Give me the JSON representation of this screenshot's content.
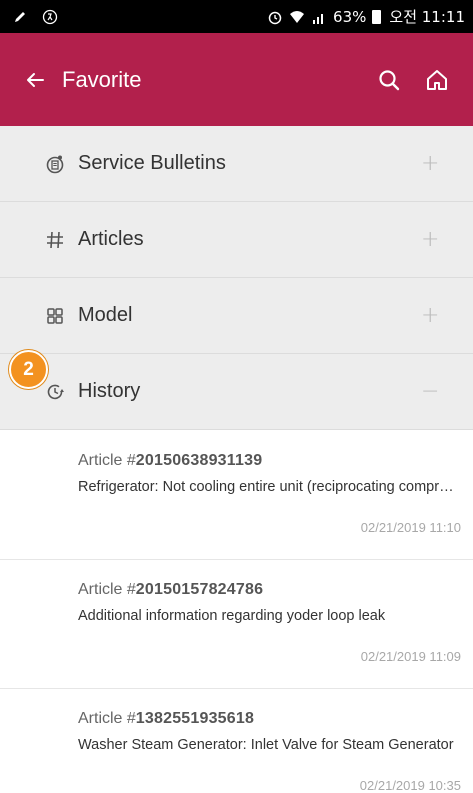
{
  "status_bar": {
    "battery_text": "63%",
    "time_text": "오전 11:11"
  },
  "app_bar": {
    "title": "Favorite"
  },
  "menu": {
    "items": [
      {
        "label": "Service Bulletins",
        "toggle": "+",
        "icon": "bulletin-icon"
      },
      {
        "label": "Articles",
        "toggle": "+",
        "icon": "hash-icon"
      },
      {
        "label": "Model",
        "toggle": "+",
        "icon": "grid-icon"
      },
      {
        "label": "History",
        "toggle": "−",
        "icon": "history-icon"
      }
    ]
  },
  "badge": {
    "text": "2"
  },
  "history": {
    "items": [
      {
        "prefix": "Article #",
        "number": "20150638931139",
        "title": "Refrigerator: Not cooling entire unit (reciprocating compressor)",
        "date": "02/21/2019 11:10"
      },
      {
        "prefix": "Article #",
        "number": "20150157824786",
        "title": "Additional information regarding yoder loop leak",
        "date": "02/21/2019 11:09"
      },
      {
        "prefix": "Article #",
        "number": "1382551935618",
        "title": "Washer Steam Generator: Inlet Valve for Steam Generator",
        "date": "02/21/2019 10:35"
      }
    ]
  },
  "colors": {
    "app_bar": "#b2204c",
    "badge": "#f39220"
  }
}
